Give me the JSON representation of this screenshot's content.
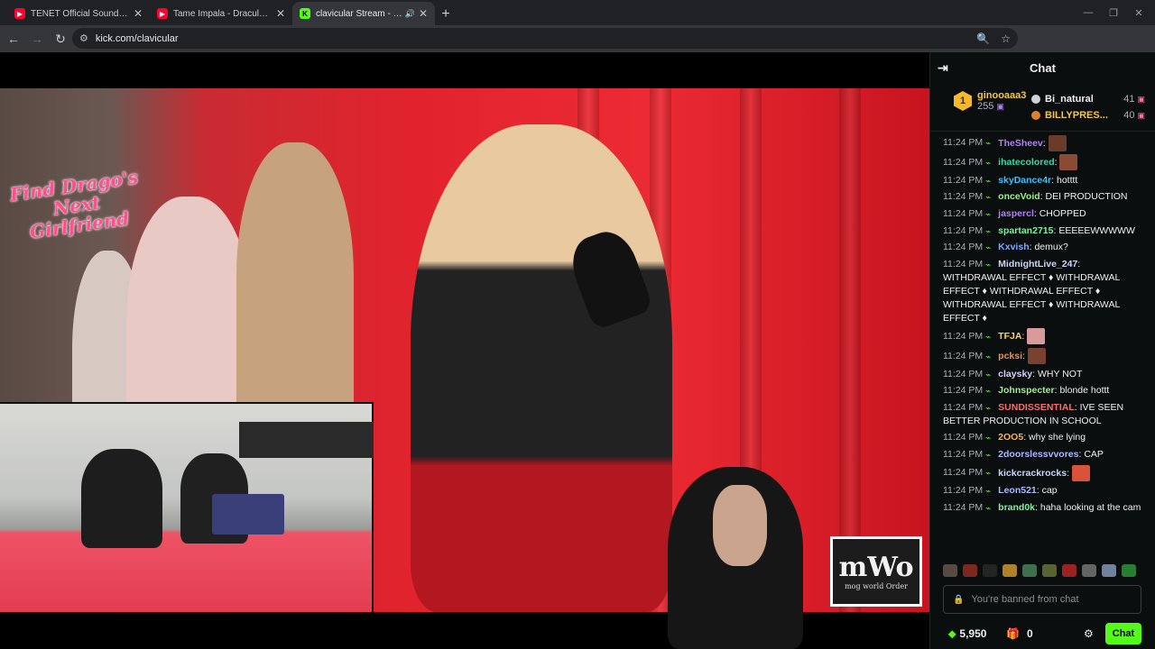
{
  "browser": {
    "tabs": [
      {
        "title": "TENET Official Soundtrack | FUL",
        "favicon": "youtube-icon"
      },
      {
        "title": "Tame Impala - Dracula (Official",
        "favicon": "youtube-icon"
      },
      {
        "title": "clavicular Stream - Watch Li",
        "favicon": "kick-icon",
        "active": true
      }
    ],
    "url": "kick.com/clavicular"
  },
  "video": {
    "overlay_badge": "Find Drago's Next Girlfriend",
    "logo_big": "mWo",
    "logo_small": "mog world Order"
  },
  "chat": {
    "title": "Chat",
    "top_gifters": [
      {
        "rank": "1",
        "name": "ginooaaa3",
        "count": "255"
      },
      {
        "name": "Bi_natural",
        "count": "41"
      },
      {
        "name": "BILLYPRES...",
        "count": "40"
      }
    ],
    "messages": [
      {
        "time": "11:24 PM",
        "user": "TheSheev",
        "text": "",
        "color": "#b57cff",
        "emote": "#6b3b2a"
      },
      {
        "time": "11:24 PM",
        "user": "ihatecolored",
        "text": "",
        "color": "#38d9a9",
        "emote": "#8a4b35"
      },
      {
        "time": "11:24 PM",
        "user": "skyDance4r",
        "text": "hotttt",
        "color": "#3ec1ff"
      },
      {
        "time": "11:24 PM",
        "user": "onceVoid",
        "text": "DEI PRODUCTION",
        "color": "#9ff089"
      },
      {
        "time": "11:24 PM",
        "user": "jaspercl",
        "text": "CHOPPED",
        "color": "#b57cff"
      },
      {
        "time": "11:24 PM",
        "user": "spartan2715",
        "text": "EEEEEWWWWW",
        "color": "#7cf2a0"
      },
      {
        "time": "11:24 PM",
        "user": "Kxvish",
        "text": "demux?",
        "color": "#7ea6ff"
      },
      {
        "time": "11:24 PM",
        "user": "MidnightLive_247",
        "text": "WITHDRAWAL EFFECT ♦ WITHDRAWAL EFFECT ♦ WITHDRAWAL EFFECT ♦ WITHDRAWAL EFFECT ♦ WITHDRAWAL EFFECT ♦",
        "color": "#c8d6ff"
      },
      {
        "time": "11:24 PM",
        "user": "TFJA",
        "text": "",
        "color": "#ffd54a",
        "emote": "#d99a9a"
      },
      {
        "time": "11:24 PM",
        "user": "pcksi",
        "text": "",
        "color": "#ff8a3d",
        "emote": "#7a4030"
      },
      {
        "time": "11:24 PM",
        "user": "claysky",
        "text": "WHY NOT",
        "color": "#d0d0ff"
      },
      {
        "time": "11:24 PM",
        "user": "Johnspecter",
        "text": "blonde hottt",
        "color": "#9ff089"
      },
      {
        "time": "11:24 PM",
        "user": "SUNDISSENTIAL",
        "text": "IVE SEEN BETTER PRODUCTION IN SCHOOL",
        "color": "#ff6b6b"
      },
      {
        "time": "11:24 PM",
        "user": "2OO5",
        "text": "why she lying",
        "color": "#ffb14a"
      },
      {
        "time": "11:24 PM",
        "user": "2doorslessvvores",
        "text": "CAP",
        "color": "#a8b8ff"
      },
      {
        "time": "11:24 PM",
        "user": "kickcrackrocks",
        "text": "",
        "color": "#c8d6ff",
        "emote": "#d9533a"
      },
      {
        "time": "11:24 PM",
        "user": "Leon521",
        "text": "cap",
        "color": "#a8b8ff"
      },
      {
        "time": "11:24 PM",
        "user": "brand0k",
        "text": "haha looking at the cam",
        "color": "#7cf2a0"
      }
    ],
    "input_placeholder": "You're banned from chat",
    "points": "5,950",
    "count": "0",
    "chat_button": "Chat"
  },
  "colors": {
    "kick_green": "#53fc18",
    "chrome_dark": "#202124",
    "chat_bg": "#0b0e0f"
  }
}
